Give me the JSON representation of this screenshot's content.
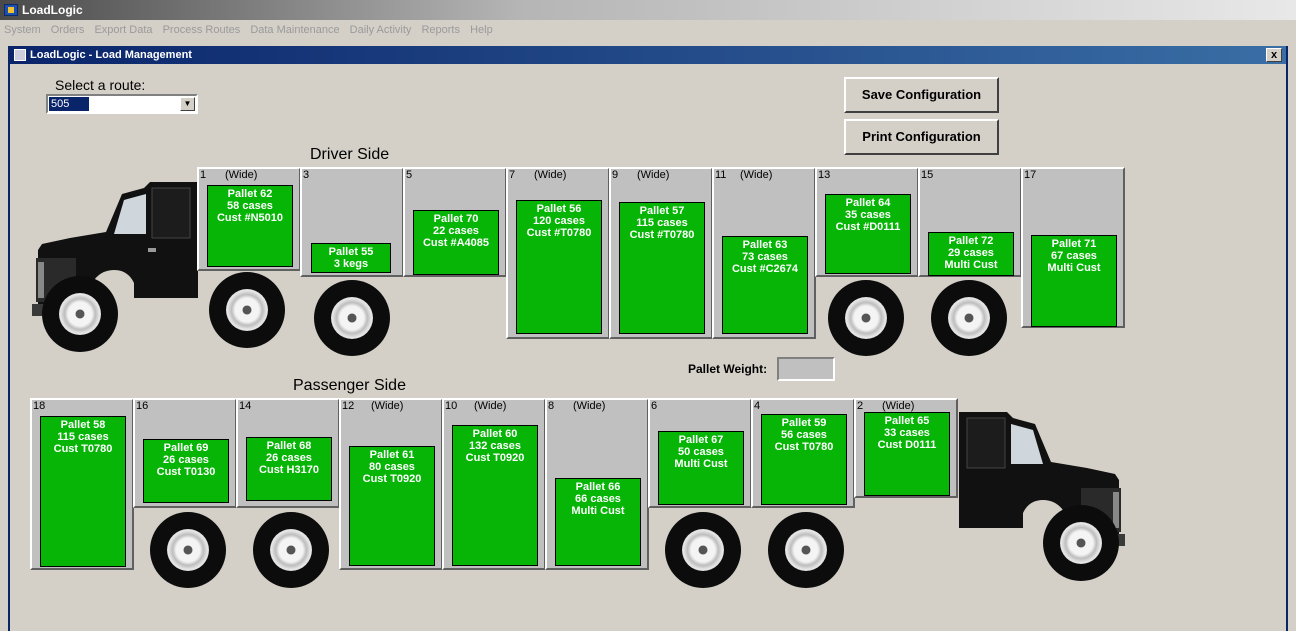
{
  "app": {
    "title": "LoadLogic"
  },
  "menu": [
    "System",
    "Orders",
    "Export Data",
    "Process Routes",
    "Data Maintenance",
    "Daily Activity",
    "Reports",
    "Help"
  ],
  "window": {
    "title": "LoadLogic - Load Management",
    "close": "x"
  },
  "route": {
    "label": "Select a route:",
    "value": "505",
    "arrow": "▼"
  },
  "buttons": {
    "save": "Save Configuration",
    "print": "Print Configuration"
  },
  "driver_side": {
    "title": "Driver Side",
    "bays": [
      {
        "num": "1",
        "wide": "(Wide)",
        "pallet": "Pallet 62",
        "qty": "58 cases",
        "cust": "Cust #N5010"
      },
      {
        "num": "3",
        "wide": "",
        "pallet": "Pallet 55",
        "qty": "3 kegs",
        "cust": ""
      },
      {
        "num": "5",
        "wide": "",
        "pallet": "Pallet 70",
        "qty": "22 cases",
        "cust": "Cust #A4085"
      },
      {
        "num": "7",
        "wide": "(Wide)",
        "pallet": "Pallet 56",
        "qty": "120 cases",
        "cust": "Cust #T0780"
      },
      {
        "num": "9",
        "wide": "(Wide)",
        "pallet": "Pallet 57",
        "qty": "115 cases",
        "cust": "Cust #T0780"
      },
      {
        "num": "11",
        "wide": "(Wide)",
        "pallet": "Pallet 63",
        "qty": "73 cases",
        "cust": "Cust #C2674"
      },
      {
        "num": "13",
        "wide": "",
        "pallet": "Pallet 64",
        "qty": "35 cases",
        "cust": "Cust #D0111"
      },
      {
        "num": "15",
        "wide": "",
        "pallet": "Pallet 72",
        "qty": "29 cases",
        "cust": "Multi Cust"
      },
      {
        "num": "17",
        "wide": "",
        "pallet": "Pallet 71",
        "qty": "67 cases",
        "cust": "Multi Cust"
      }
    ]
  },
  "pallet_weight": {
    "label": "Pallet Weight:",
    "value": ""
  },
  "passenger_side": {
    "title": "Passenger Side",
    "bays": [
      {
        "num": "18",
        "wide": "",
        "pallet": "Pallet 58",
        "qty": "115 cases",
        "cust": "Cust T0780"
      },
      {
        "num": "16",
        "wide": "",
        "pallet": "Pallet 69",
        "qty": "26 cases",
        "cust": "Cust T0130"
      },
      {
        "num": "14",
        "wide": "",
        "pallet": "Pallet 68",
        "qty": "26 cases",
        "cust": "Cust H3170"
      },
      {
        "num": "12",
        "wide": "(Wide)",
        "pallet": "Pallet 61",
        "qty": "80 cases",
        "cust": "Cust T0920"
      },
      {
        "num": "10",
        "wide": "(Wide)",
        "pallet": "Pallet 60",
        "qty": "132 cases",
        "cust": "Cust T0920"
      },
      {
        "num": "8",
        "wide": "(Wide)",
        "pallet": "Pallet 66",
        "qty": "66 cases",
        "cust": "Multi Cust"
      },
      {
        "num": "6",
        "wide": "",
        "pallet": "Pallet 67",
        "qty": "50 cases",
        "cust": "Multi Cust"
      },
      {
        "num": "4",
        "wide": "",
        "pallet": "Pallet 59",
        "qty": "56 cases",
        "cust": "Cust T0780"
      },
      {
        "num": "2",
        "wide": "(Wide)",
        "pallet": "Pallet 65",
        "qty": "33 cases",
        "cust": "Cust D0111"
      }
    ]
  },
  "colors": {
    "pallet": "#06b506",
    "bay": "#c0c0c0",
    "title_bar": "#0a246a"
  }
}
